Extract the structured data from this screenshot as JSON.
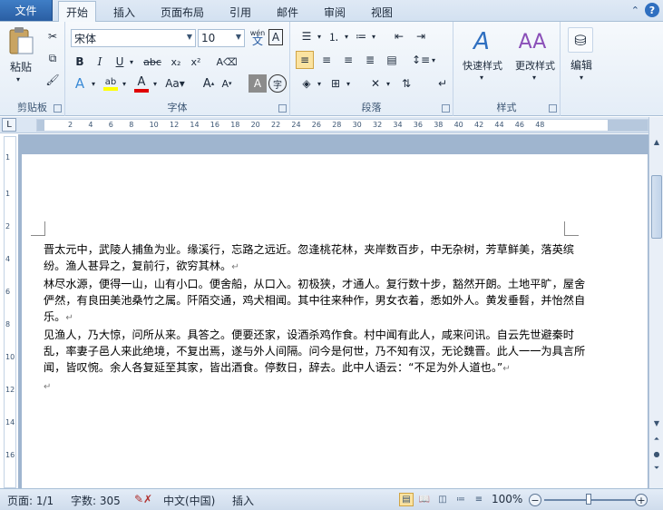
{
  "tabs": {
    "file": "文件",
    "items": [
      "开始",
      "插入",
      "页面布局",
      "引用",
      "邮件",
      "审阅",
      "视图"
    ]
  },
  "ribbon": {
    "clipboard": {
      "paste": "粘贴",
      "label": "剪贴板"
    },
    "font": {
      "font_name": "宋体",
      "font_size": "10",
      "wen_label": "wén",
      "label": "字体"
    },
    "paragraph": {
      "label": "段落"
    },
    "styles": {
      "quick": "快速样式",
      "change": "更改样式",
      "label": "样式"
    },
    "editing": {
      "label": "编辑"
    }
  },
  "ruler": {
    "ticks": [
      "2",
      "4",
      "6",
      "8",
      "10",
      "12",
      "14",
      "16",
      "18",
      "20",
      "22",
      "24",
      "26",
      "28",
      "30",
      "32",
      "34",
      "36",
      "38",
      "40",
      "42",
      "44",
      "46",
      "48"
    ]
  },
  "document": {
    "paragraphs": [
      "晋太元中，武陵人捕鱼为业。缘溪行，忘路之远近。忽逢桃花林，夹岸数百步，中无杂树，芳草鲜美，落英缤纷。渔人甚异之，复前行，欲穷其林。",
      "林尽水源，便得一山，山有小口。便舍船，从口入。初极狭，才通人。复行数十步，豁然开朗。土地平旷，屋舍俨然，有良田美池桑竹之属。阡陌交通，鸡犬相闻。其中往来种作，男女衣着，悉如外人。黄发垂髫，并怡然自乐。",
      "见渔人，乃大惊，问所从来。具答之。便要还家，设酒杀鸡作食。村中闻有此人，咸来问讯。自云先世避秦时乱，率妻子邑人来此绝境，不复出焉，遂与外人间隔。问今是何世，乃不知有汉，无论魏晋。此人一一为具言所闻，皆叹惋。余人各复延至其家，皆出酒食。停数日，辞去。此中人语云：“不足为外人道也。”"
    ],
    "para_mark": "↵"
  },
  "status": {
    "page": "页面: 1/1",
    "words": "字数: 305",
    "language": "中文(中国)",
    "mode": "插入",
    "zoom": "100%"
  }
}
